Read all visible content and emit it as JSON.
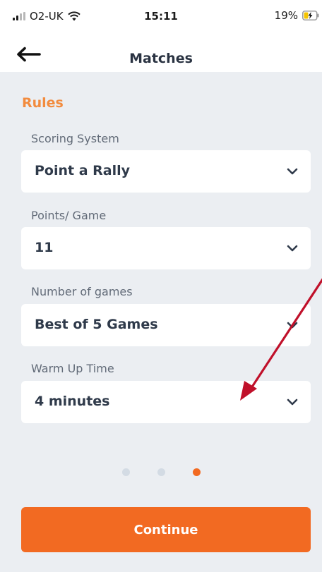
{
  "status_bar": {
    "carrier": "O2-UK",
    "time": "15:11",
    "battery_percent": "19%",
    "icons": [
      "signal-icon",
      "wifi-icon",
      "battery-charging-icon"
    ]
  },
  "header": {
    "title": "Matches",
    "back_icon": "arrow-left-icon"
  },
  "rules": {
    "title": "Rules",
    "fields": [
      {
        "label": "Scoring System",
        "value": "Point a Rally"
      },
      {
        "label": "Points/ Game",
        "value": "11"
      },
      {
        "label": "Number of games",
        "value": "Best of 5 Games"
      },
      {
        "label": "Warm Up Time",
        "value": "4 minutes"
      }
    ],
    "chevron_icon": "chevron-down-icon"
  },
  "pager": {
    "page_count": 3,
    "active_page": 3
  },
  "footer": {
    "continue_label": "Continue"
  },
  "colors": {
    "accent": "#f26a22",
    "section_title": "#f28b3e",
    "background": "#ebeef2",
    "annotation_arrow": "#c0102a"
  }
}
